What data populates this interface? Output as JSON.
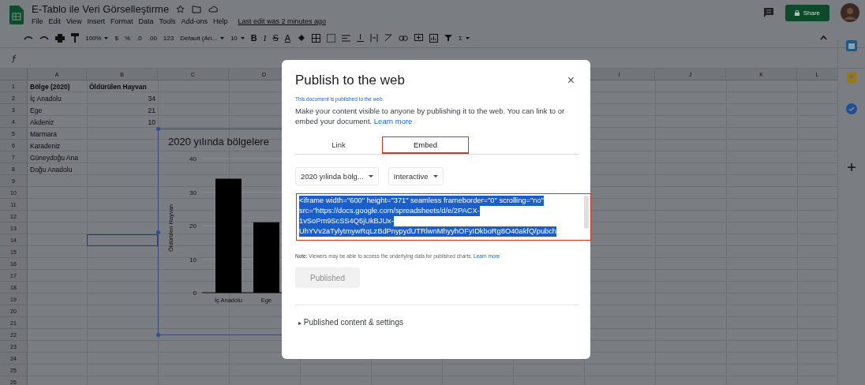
{
  "app": {
    "title": "E-Tablo ile Veri Görselleştirme",
    "menu": [
      "File",
      "Edit",
      "View",
      "Insert",
      "Format",
      "Data",
      "Tools",
      "Add-ons",
      "Help"
    ],
    "last_edit": "Last edit was 2 minutes ago",
    "share_label": "Share"
  },
  "toolbar": {
    "zoom": "100%",
    "number_formats": [
      "$",
      "%",
      ".0",
      ".00",
      "123"
    ],
    "font": "Default (Ari...",
    "font_size": "10",
    "text_formats": [
      "B",
      "I",
      "S",
      "A"
    ],
    "sum": "Σ"
  },
  "sheet": {
    "columns_left": [
      "A",
      "B",
      "C",
      "D"
    ],
    "columns_right": [
      "I",
      "J",
      "K",
      "L"
    ],
    "rows": [
      {
        "number": "1",
        "cells": [
          "Bölge (2020)",
          "Öldürülen Hayvan"
        ],
        "header": true,
        "active": false
      },
      {
        "number": "2",
        "cells": [
          "İç Anadolu",
          "34"
        ],
        "header": false,
        "active": false
      },
      {
        "number": "3",
        "cells": [
          "Ege",
          "21"
        ],
        "header": false,
        "active": false
      },
      {
        "number": "4",
        "cells": [
          "Akdeniz",
          "10"
        ],
        "header": false,
        "active": false
      },
      {
        "number": "5",
        "cells": [
          "Marmara"
        ],
        "header": false,
        "active": false
      },
      {
        "number": "6",
        "cells": [
          "Karadeniz"
        ],
        "header": false,
        "active": false
      },
      {
        "number": "7",
        "cells": [
          "Güneydoğu Ana"
        ],
        "header": false,
        "active": false
      },
      {
        "number": "8",
        "cells": [
          "Doğu Anadolu"
        ],
        "header": false,
        "active": false
      },
      {
        "number": "9",
        "active": false
      },
      {
        "number": "10",
        "active": false
      },
      {
        "number": "11",
        "active": false
      },
      {
        "number": "12",
        "active": false
      },
      {
        "number": "13",
        "active": false
      },
      {
        "number": "14",
        "active": true
      },
      {
        "number": "15",
        "active": false
      },
      {
        "number": "16",
        "active": false
      },
      {
        "number": "17",
        "active": false
      },
      {
        "number": "18",
        "active": false
      },
      {
        "number": "19",
        "active": false
      },
      {
        "number": "20",
        "active": false
      },
      {
        "number": "21",
        "active": false
      },
      {
        "number": "22",
        "active": false
      },
      {
        "number": "23",
        "active": false
      },
      {
        "number": "24",
        "active": false
      },
      {
        "number": "25",
        "active": false
      },
      {
        "number": "26",
        "active": false
      }
    ]
  },
  "chart": {
    "title": "2020 yılında bölgelere",
    "chart_data": {
      "type": "bar",
      "ylabel": "Öldürülen Hayvan",
      "categories": [
        "İç Anadolu",
        "Ege"
      ],
      "series": [
        {
          "color": "#000000",
          "values": [
            34,
            21
          ]
        }
      ],
      "ylim": [
        0,
        40
      ],
      "yticks": [
        0,
        10,
        20,
        30,
        40
      ],
      "grid": true
    }
  },
  "dialog": {
    "title": "Publish to the web",
    "close": "×",
    "status": "This document is published to the web.",
    "description": "Make your content visible to anyone by publishing it to the web. You can link to or embed your document.",
    "description_link": "Learn more",
    "tabs": [
      {
        "label": "Link",
        "selected": false,
        "highlighted": false
      },
      {
        "label": "Embed",
        "selected": true,
        "highlighted": true
      }
    ],
    "dropdowns": [
      "2020 yılinda bölg...",
      "Interactive"
    ],
    "code": {
      "selected": true,
      "highlighted": true,
      "lines": [
        "<iframe width=\"600\" height=\"371\" seamless frameborder=\"0\" scrolling=\"no\"",
        "src=\"https://docs.google.com/spreadsheets/d/e/2PACX-",
        "1vSoPm9ScSS4Q5jUkBJUx-",
        "UhYVv2aTylytmywRqLzBdPnypydUTRlwnMhyyhOFyIDkboRg8O40akfQ/pubch"
      ]
    },
    "note_label": "Note:",
    "note": "Viewers may be able to access the underlying data for published charts.",
    "note_link": "Learn more",
    "publish_button": {
      "label": "Published",
      "disabled": true
    },
    "expander": {
      "icon": "▸",
      "label": "Published content & settings",
      "expanded": false
    }
  }
}
